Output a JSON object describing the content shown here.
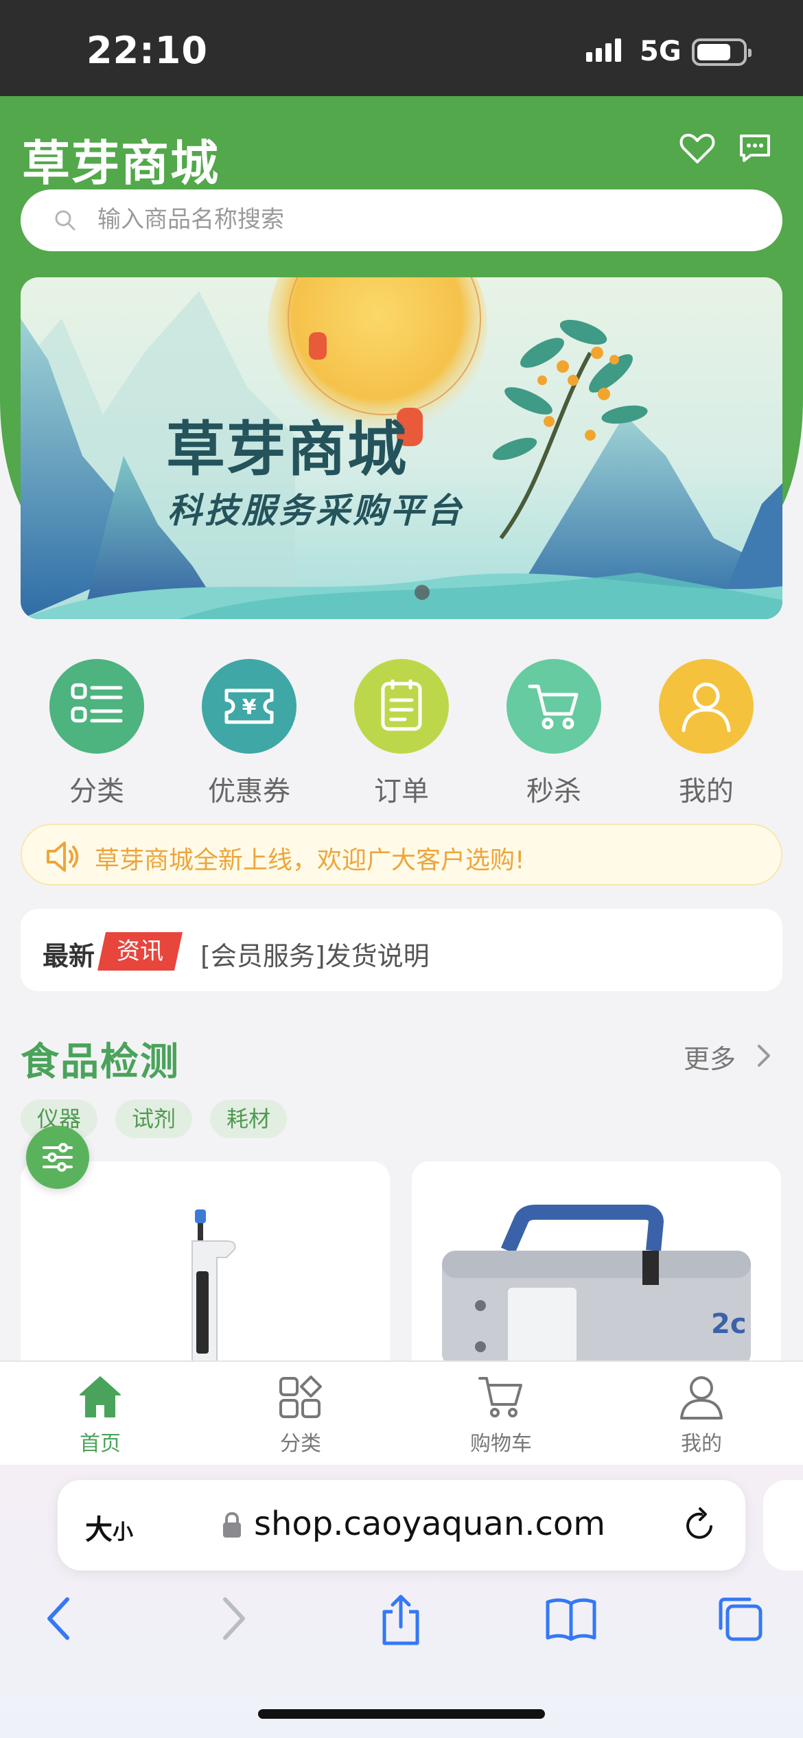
{
  "status_bar": {
    "time": "22:10",
    "network": "5G"
  },
  "header": {
    "title": "草芽商城",
    "search_placeholder": "输入商品名称搜索"
  },
  "banner": {
    "title": "草芽商城",
    "subtitle": "科技服务采购平台"
  },
  "quick_menu": [
    {
      "label": "分类",
      "icon": "list-icon",
      "color": "#4db37f"
    },
    {
      "label": "优惠券",
      "icon": "coupon-icon",
      "color": "#3fa7a5"
    },
    {
      "label": "订单",
      "icon": "order-icon",
      "color": "#bcd84a"
    },
    {
      "label": "秒杀",
      "icon": "cart-icon",
      "color": "#66cba0"
    },
    {
      "label": "我的",
      "icon": "user-icon",
      "color": "#f4c23d"
    }
  ],
  "notice": {
    "text": "草芽商城全新上线，欢迎广大客户选购!"
  },
  "news": {
    "latest": "最新",
    "badge": "资讯",
    "text": "[会员服务]发货说明"
  },
  "section": {
    "title": "食品检测",
    "more": "更多",
    "chips": [
      "仪器",
      "试剂",
      "耗材"
    ]
  },
  "tab_bar": [
    {
      "label": "首页",
      "icon": "home-icon",
      "active": true
    },
    {
      "label": "分类",
      "icon": "category-icon",
      "active": false
    },
    {
      "label": "购物车",
      "icon": "cart-icon",
      "active": false
    },
    {
      "label": "我的",
      "icon": "user-icon",
      "active": false
    }
  ],
  "browser": {
    "size_label": "大",
    "size_label_small": "小",
    "url": "shop.caoyaquan.com"
  },
  "colors": {
    "brand_green": "#52a84a",
    "section_green": "#4aa35a",
    "notice_orange": "#eea53d",
    "badge_red": "#e8453c",
    "safari_blue": "#3478f6"
  }
}
